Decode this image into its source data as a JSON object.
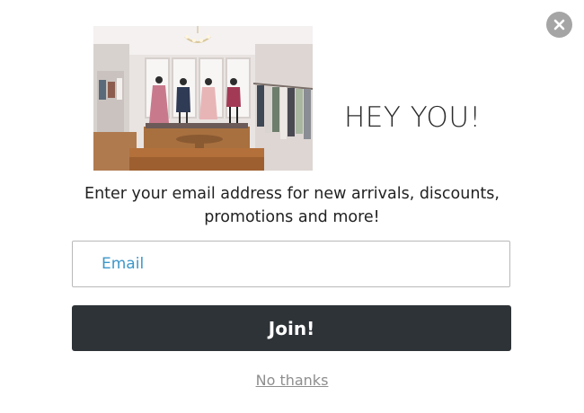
{
  "popup": {
    "close_icon": "close-icon",
    "image": {
      "subject": "boutique store interior"
    },
    "headline": "HEY YOU!",
    "description": "Enter your email address for new arrivals, discounts, promotions and more!",
    "email_field": {
      "placeholder": "Email",
      "value": ""
    },
    "join_button_label": "Join!",
    "no_thanks_label": "No thanks"
  },
  "colors": {
    "button_background": "#2e3338",
    "placeholder_color": "#3d97c9",
    "link_color": "#8e8e8e",
    "close_button": "#a5a5a5"
  }
}
